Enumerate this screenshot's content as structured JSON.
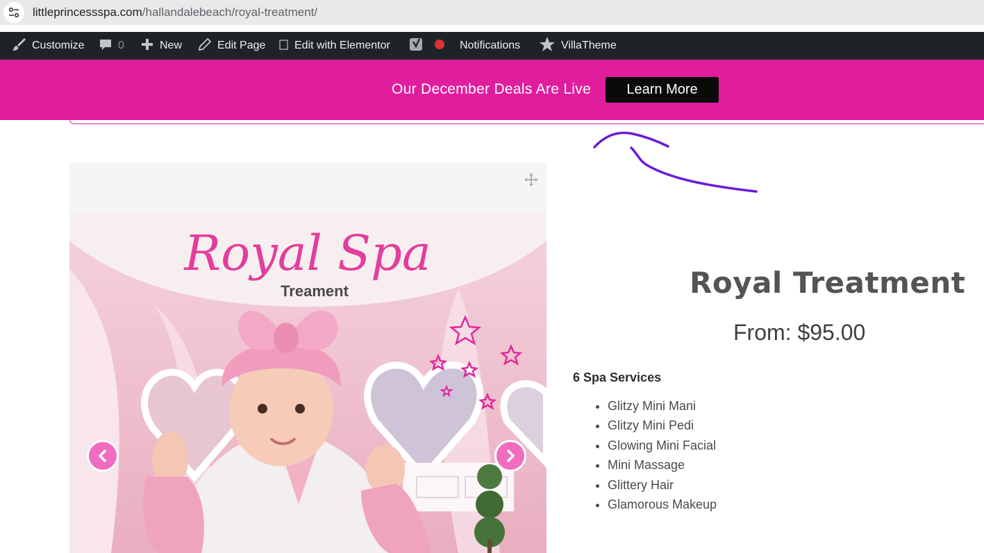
{
  "browser": {
    "url_domain": "littleprincessspa.com",
    "url_path": "/hallandalebeach/royal-treatment/"
  },
  "admin_bar": {
    "customize": "Customize",
    "comments_count": "0",
    "new": "New",
    "edit_page": "Edit Page",
    "edit_elementor": "Edit with Elementor",
    "notifications": "Notifications",
    "villatheme": "VillaTheme"
  },
  "promo": {
    "text": "Our December Deals Are Live",
    "button": "Learn More"
  },
  "gallery": {
    "image_title": "Royal Spa",
    "image_subtitle": "Treament"
  },
  "product": {
    "title": "Royal Treatment",
    "price": "From: $95.00",
    "services_heading": "6 Spa Services",
    "services": [
      "Glitzy Mini Mani",
      "Glitzy Mini Pedi",
      "Glowing Mini Facial",
      "Mini Massage",
      "Glittery Hair",
      "Glamorous Makeup"
    ]
  },
  "colors": {
    "promo_bg": "#e01d9d",
    "admin_bar_bg": "#1d2327",
    "annotation": "#6a1bd6",
    "arrow_bg": "#f06cbf"
  }
}
